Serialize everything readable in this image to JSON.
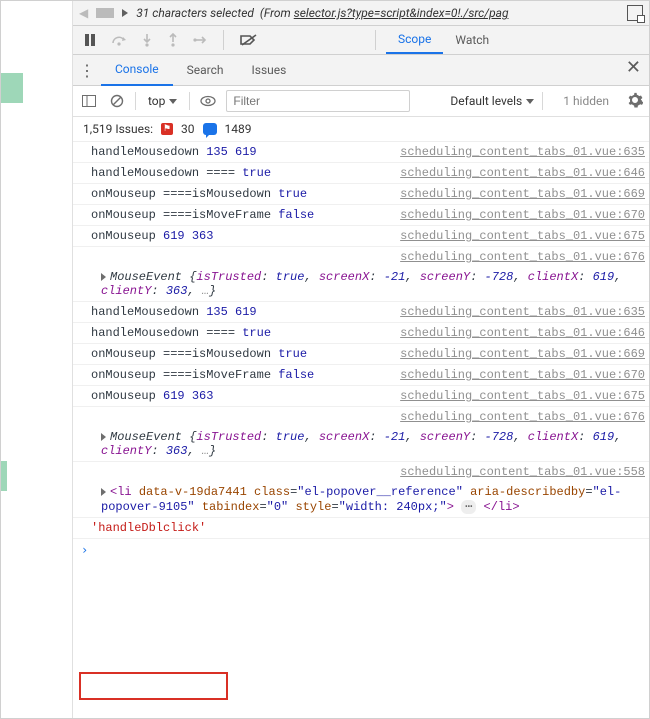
{
  "topbar": {
    "selected_count": "31 characters selected",
    "from_prefix": "(From ",
    "from_link": "selector.js?type=script&index=0!./src/pag"
  },
  "scope_tabs": {
    "scope": "Scope",
    "watch": "Watch"
  },
  "drawer": {
    "console": "Console",
    "search": "Search",
    "issues": "Issues"
  },
  "console_toolbar": {
    "context": "top",
    "filter_placeholder": "Filter",
    "levels": "Default levels",
    "hidden": "1 hidden"
  },
  "issues_bar": {
    "label": "1,519 Issues:",
    "err_count": "30",
    "info_count": "1489"
  },
  "source_file": "scheduling_content_tabs_01.vue",
  "logs": [
    {
      "kind": "log",
      "parts": [
        {
          "t": "plain",
          "v": "handleMousedown "
        },
        {
          "t": "num",
          "v": "135"
        },
        {
          "t": "plain",
          "v": " "
        },
        {
          "t": "num",
          "v": "619"
        }
      ],
      "line": "635"
    },
    {
      "kind": "log",
      "parts": [
        {
          "t": "plain",
          "v": "handleMousedown ==== "
        },
        {
          "t": "bool",
          "v": "true"
        }
      ],
      "line": "646"
    },
    {
      "kind": "log",
      "parts": [
        {
          "t": "plain",
          "v": "onMouseup ====isMousedown "
        },
        {
          "t": "bool",
          "v": "true"
        }
      ],
      "line": "669"
    },
    {
      "kind": "log",
      "parts": [
        {
          "t": "plain",
          "v": "onMouseup ====isMoveFrame "
        },
        {
          "t": "bool",
          "v": "false"
        }
      ],
      "line": "670"
    },
    {
      "kind": "log",
      "parts": [
        {
          "t": "plain",
          "v": "onMouseup "
        },
        {
          "t": "num",
          "v": "619"
        },
        {
          "t": "plain",
          "v": " "
        },
        {
          "t": "num",
          "v": "363"
        }
      ],
      "line": "675"
    },
    {
      "kind": "srconly",
      "line": "676"
    },
    {
      "kind": "obj",
      "text_before": "MouseEvent ",
      "body": "{isTrusted: true, screenX: -21, screenY: -728, clientX: 619, clientY: 363, …}"
    },
    {
      "kind": "log",
      "parts": [
        {
          "t": "plain",
          "v": "handleMousedown "
        },
        {
          "t": "num",
          "v": "135"
        },
        {
          "t": "plain",
          "v": " "
        },
        {
          "t": "num",
          "v": "619"
        }
      ],
      "line": "635"
    },
    {
      "kind": "log",
      "parts": [
        {
          "t": "plain",
          "v": "handleMousedown ==== "
        },
        {
          "t": "bool",
          "v": "true"
        }
      ],
      "line": "646"
    },
    {
      "kind": "log",
      "parts": [
        {
          "t": "plain",
          "v": "onMouseup ====isMousedown "
        },
        {
          "t": "bool",
          "v": "true"
        }
      ],
      "line": "669"
    },
    {
      "kind": "log",
      "parts": [
        {
          "t": "plain",
          "v": "onMouseup ====isMoveFrame "
        },
        {
          "t": "bool",
          "v": "false"
        }
      ],
      "line": "670"
    },
    {
      "kind": "log",
      "parts": [
        {
          "t": "plain",
          "v": "onMouseup "
        },
        {
          "t": "num",
          "v": "619"
        },
        {
          "t": "plain",
          "v": " "
        },
        {
          "t": "num",
          "v": "363"
        }
      ],
      "line": "675"
    },
    {
      "kind": "srconly",
      "line": "676"
    },
    {
      "kind": "obj",
      "text_before": "MouseEvent ",
      "body": "{isTrusted: true, screenX: -21, screenY: -728, clientX: 619, clientY: 363, …}"
    },
    {
      "kind": "srconly",
      "line": "558"
    },
    {
      "kind": "html"
    },
    {
      "kind": "str",
      "value": "'handleDblclick'"
    }
  ],
  "html_log": {
    "open": "<li",
    "attrs": [
      {
        "n": "data-v-19da7441",
        "v": null
      },
      {
        "n": "class",
        "v": "el-popover__reference"
      },
      {
        "n": "aria-describedby",
        "v": "el-popover-9105"
      },
      {
        "n": "tabindex",
        "v": "0"
      },
      {
        "n": "style",
        "v": "width: 240px;"
      }
    ],
    "close_open": ">",
    "close": "</li>"
  },
  "prompt": ">"
}
